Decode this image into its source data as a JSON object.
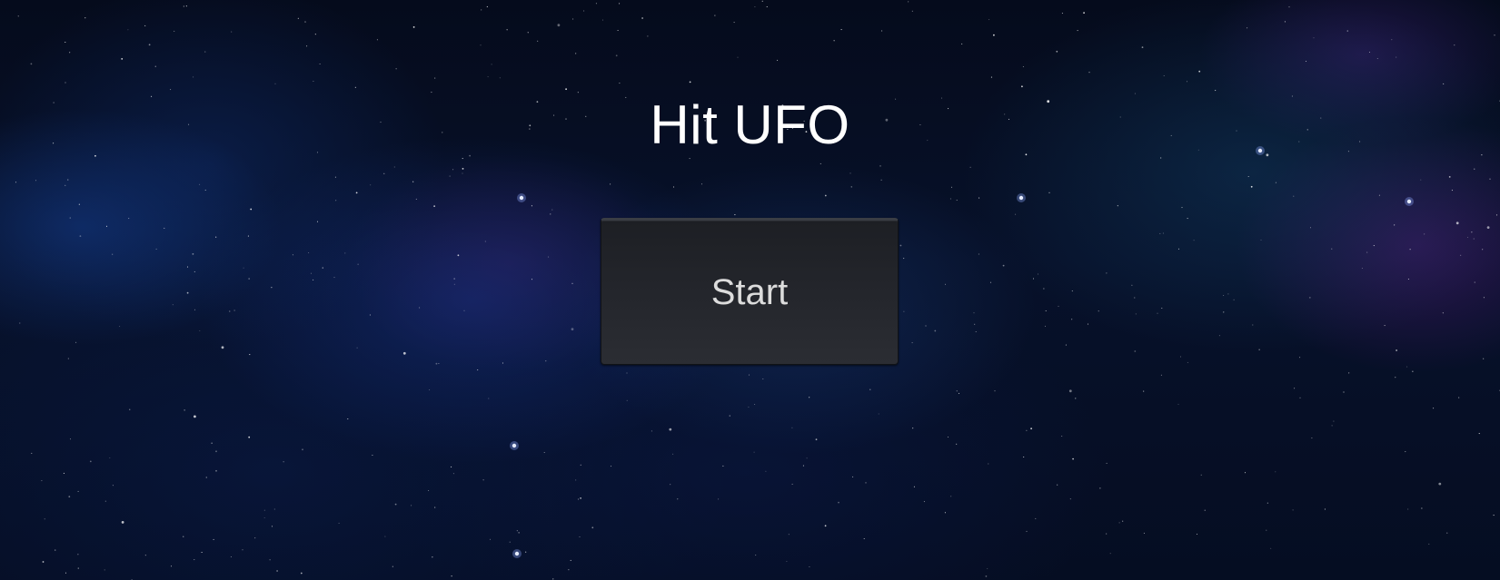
{
  "game": {
    "title": "Hit UFO",
    "start_label": "Start"
  },
  "colors": {
    "background": "#050b1c",
    "title_text": "#ffffff",
    "button_bg": "#23252b",
    "button_text": "#dcdcdc"
  }
}
